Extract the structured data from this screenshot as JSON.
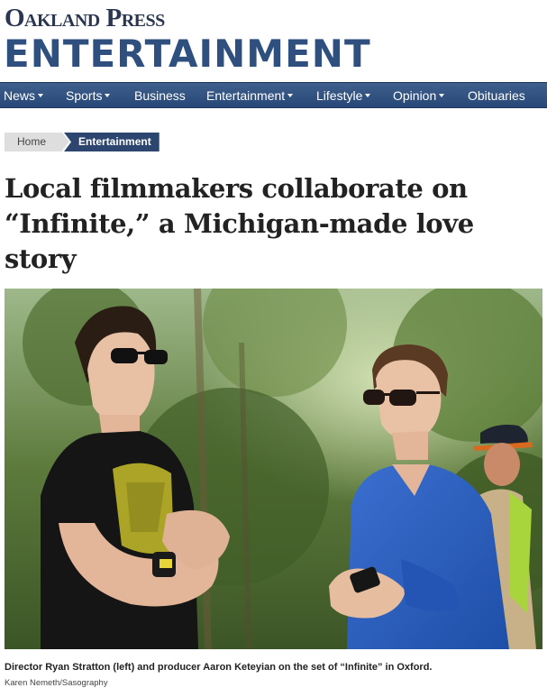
{
  "masthead": {
    "brand": "Oakland Press",
    "section": "ENTERTAINMENT"
  },
  "nav": {
    "items": [
      {
        "label": "News",
        "dropdown": true
      },
      {
        "label": "Sports",
        "dropdown": true
      },
      {
        "label": "Business",
        "dropdown": false
      },
      {
        "label": "Entertainment",
        "dropdown": true
      },
      {
        "label": "Lifestyle",
        "dropdown": true
      },
      {
        "label": "Opinion",
        "dropdown": true
      },
      {
        "label": "Obituaries",
        "dropdown": false
      }
    ]
  },
  "breadcrumb": {
    "home": "Home",
    "current": "Entertainment"
  },
  "article": {
    "headline": "Local filmmakers collaborate on “Infinite,” a Michigan-made love story",
    "caption": "Director Ryan Stratton (left) and producer Aaron Keteyian on the set of “Infinite” in Oxford.",
    "credit": "Karen Nemeth/Sasography"
  },
  "colors": {
    "brand_navy": "#2b3650",
    "section_blue": "#2f4f7f",
    "nav_bar": "#274878",
    "breadcrumb_active": "#2c4670"
  }
}
